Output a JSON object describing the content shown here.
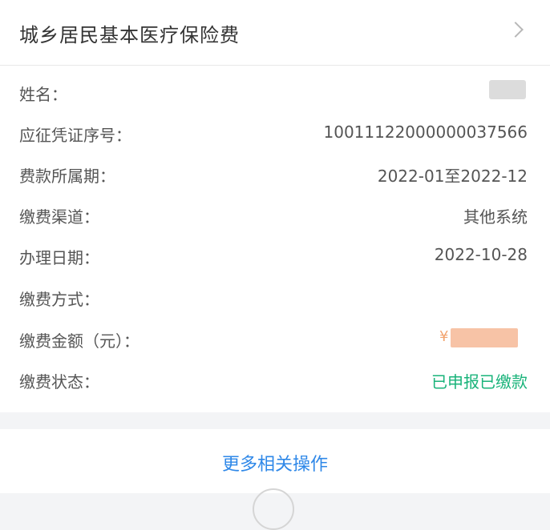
{
  "header": {
    "title": "城乡居民基本医疗保险费"
  },
  "fields": [
    {
      "label": "姓名：",
      "value": ""
    },
    {
      "label": "应征凭证序号：",
      "value": "10011122000000037566"
    },
    {
      "label": "费款所属期：",
      "value": "2022-01至2022-12"
    },
    {
      "label": "缴费渠道：",
      "value": "其他系统"
    },
    {
      "label": "办理日期：",
      "value": "2022-10-28"
    },
    {
      "label": "缴费方式：",
      "value": ""
    },
    {
      "label": "缴费金额（元）：",
      "value": ""
    },
    {
      "label": "缴费状态：",
      "value": "已申报已缴款"
    }
  ],
  "amount": {
    "currency_symbol": "¥"
  },
  "footer": {
    "more_actions_label": "更多相关操作"
  },
  "colors": {
    "status_success": "#19b37a",
    "link_blue": "#2f88e8",
    "amount_orange": "#f2a46f"
  }
}
